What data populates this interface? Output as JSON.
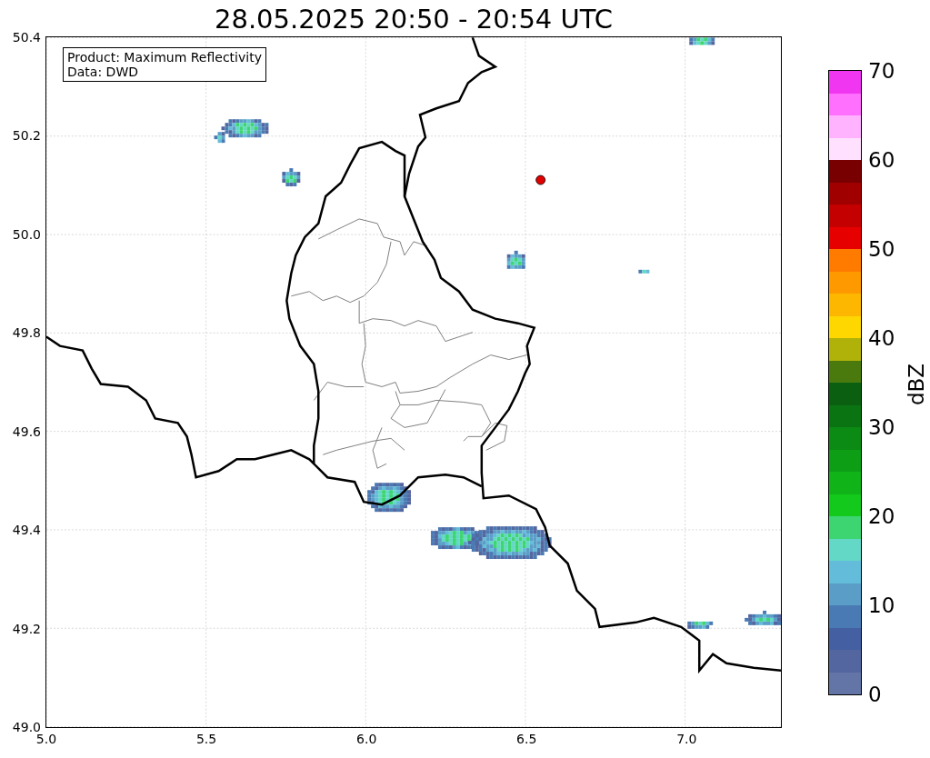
{
  "title": "28.05.2025 20:50 - 20:54 UTC",
  "info_box": [
    "Product: Maximum Reflectivity",
    "Data: DWD"
  ],
  "x_ticks": [
    "5.0",
    "5.5",
    "6.0",
    "6.5",
    "7.0"
  ],
  "y_ticks": [
    "50.4",
    "50.2",
    "50.0",
    "49.8",
    "49.6",
    "49.4",
    "49.2",
    "49.0"
  ],
  "colorbar": {
    "label": "dBZ",
    "ticks": [
      "70",
      "60",
      "50",
      "40",
      "30",
      "20",
      "10",
      "0"
    ],
    "segments": [
      {
        "color": "#6374a6"
      },
      {
        "color": "#5466a0"
      },
      {
        "color": "#4460a2"
      },
      {
        "color": "#4a7ab3"
      },
      {
        "color": "#5a9ec8"
      },
      {
        "color": "#63bcd9"
      },
      {
        "color": "#63d8c6"
      },
      {
        "color": "#3dd572"
      },
      {
        "color": "#13c91c"
      },
      {
        "color": "#10b418"
      },
      {
        "color": "#0d9e16"
      },
      {
        "color": "#0b8a14"
      },
      {
        "color": "#0a7412"
      },
      {
        "color": "#0a5f10"
      },
      {
        "color": "#4a7a0e"
      },
      {
        "color": "#b0b20a"
      },
      {
        "color": "#fed700"
      },
      {
        "color": "#fdb700"
      },
      {
        "color": "#fe9a00"
      },
      {
        "color": "#ff7b00"
      },
      {
        "color": "#e60000"
      },
      {
        "color": "#c40000"
      },
      {
        "color": "#a00000"
      },
      {
        "color": "#780000"
      },
      {
        "color": "#ffe0ff"
      },
      {
        "color": "#ffb3ff"
      },
      {
        "color": "#ff70ff"
      },
      {
        "color": "#f036f0"
      }
    ]
  }
}
